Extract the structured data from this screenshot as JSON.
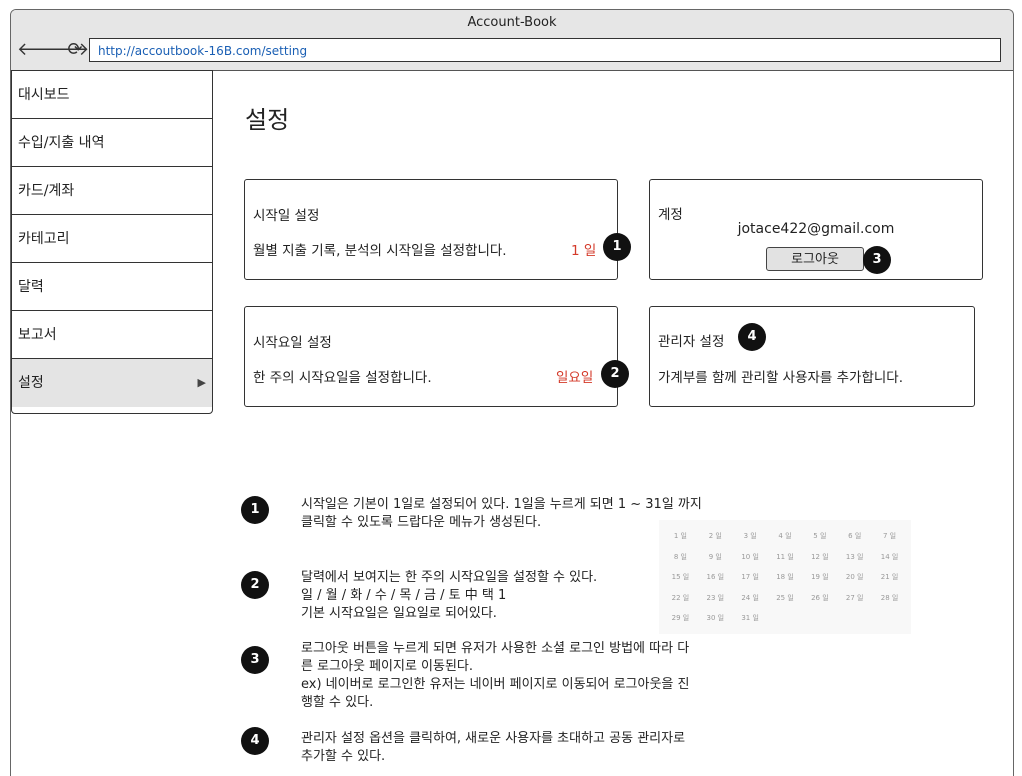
{
  "window": {
    "title": "Account-Book",
    "url": "http://accoutbook-16B.com/setting"
  },
  "nav": {
    "back": "🡐",
    "forward": "🡒",
    "reload": "⟳"
  },
  "sidebar": {
    "items": [
      {
        "label": "대시보드"
      },
      {
        "label": "수입/지출 내역"
      },
      {
        "label": "카드/계좌"
      },
      {
        "label": "카테고리"
      },
      {
        "label": "달력"
      },
      {
        "label": "보고서"
      },
      {
        "label": "설정",
        "arrow": "▶"
      }
    ]
  },
  "page": {
    "title": "설정"
  },
  "cards": {
    "start_day": {
      "title": "시작일 설정",
      "desc": "월별 지출 기록, 분석의 시작일을 설정합니다.",
      "value": "1 일",
      "badge": "1"
    },
    "account": {
      "title": "계정",
      "email": "jotace422@gmail.com",
      "logout": "로그아웃",
      "badge": "3"
    },
    "start_weekday": {
      "title": "시작요일 설정",
      "desc": "한 주의 시작요일을 설정합니다.",
      "value": "일요일",
      "badge": "2"
    },
    "admin": {
      "title": "관리자 설정",
      "desc": "가계부를 함께 관리할 사용자를 추가합니다.",
      "badge": "4"
    }
  },
  "notes": [
    {
      "badge": "1",
      "lines": [
        "시작일은 기본이 1일로 설정되어 있다. 1일을 누르게 되면 1 ~ 31일 까지",
        "클릭할 수 있도록 드랍다운 메뉴가 생성된다."
      ]
    },
    {
      "badge": "2",
      "lines": [
        "달력에서 보여지는 한 주의 시작요일을 설정할 수 있다.",
        "일 / 월 / 화 / 수 / 목 / 금 / 토 中 택 1",
        "기본 시작요일은 일요일로 되어있다."
      ]
    },
    {
      "badge": "3",
      "lines": [
        "로그아웃 버튼을 누르게 되면 유저가 사용한 소셜 로그인 방법에 따라 다",
        "른 로그아웃 페이지로 이동된다.",
        "ex) 네이버로 로그인한 유저는 네이버 페이지로 이동되어 로그아웃을 진",
        "행할 수 있다."
      ]
    },
    {
      "badge": "4",
      "lines": [
        "관리자 설정 옵션을 클릭하여, 새로운 사용자를 초대하고 공동 관리자로",
        "추가할 수 있다."
      ]
    }
  ],
  "calendar_days": [
    "1 일",
    "2 일",
    "3 일",
    "4 일",
    "5 일",
    "6 일",
    "7 일",
    "8 일",
    "9 일",
    "10 일",
    "11 일",
    "12 일",
    "13 일",
    "14 일",
    "15 일",
    "16 일",
    "17 일",
    "18 일",
    "19 일",
    "20 일",
    "21 일",
    "22 일",
    "23 일",
    "24 일",
    "25 일",
    "26 일",
    "27 일",
    "28 일",
    "29 일",
    "30 일",
    "31 일"
  ]
}
